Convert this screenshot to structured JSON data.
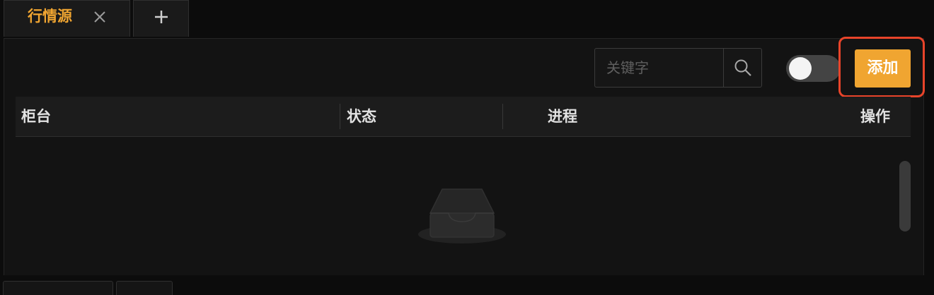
{
  "tabs": {
    "active_title": "行情源",
    "close_icon": "close-icon",
    "add_icon": "plus-icon"
  },
  "toolbar": {
    "search_placeholder": "关键字",
    "search_value": "",
    "search_icon": "search-icon",
    "toggle_state": "off",
    "add_label": "添加"
  },
  "table": {
    "columns": [
      "柜台",
      "状态",
      "进程",
      "操作"
    ],
    "rows": [],
    "empty_icon": "empty-inbox-icon"
  },
  "colors": {
    "accent": "#f0a531",
    "highlight": "#e8442a",
    "background": "#131313"
  }
}
